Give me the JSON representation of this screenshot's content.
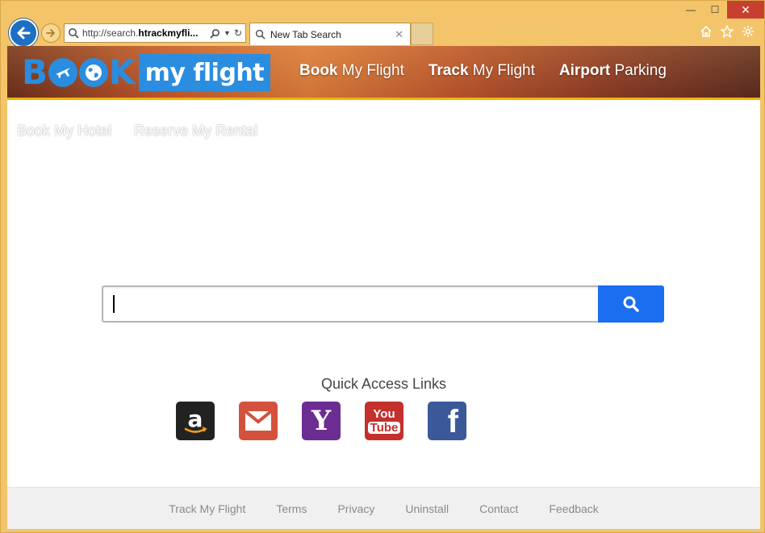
{
  "browser": {
    "address": {
      "prefix": "http://search.",
      "domain": "htrackmyfli...",
      "full_url_visible": "http://search.htrackmyfli..."
    },
    "tab": {
      "title": "New Tab Search"
    },
    "icons": [
      "home-icon",
      "star-icon",
      "gear-icon"
    ],
    "window_controls": [
      "minimize",
      "maximize",
      "close"
    ]
  },
  "site": {
    "logo": {
      "book_letters": [
        "B",
        "K"
      ],
      "box_text": "my flight",
      "brand_color": "#2a8de0"
    },
    "main_nav": [
      {
        "bold": "Book",
        "rest": " My Flight"
      },
      {
        "bold": "Track",
        "rest": " My Flight"
      },
      {
        "bold": "Airport",
        "rest": " Parking"
      }
    ],
    "sub_nav": [
      "Book My Hotel",
      "Reserve My Rental"
    ],
    "search": {
      "value": "",
      "placeholder": "",
      "button_color": "#1a6ff1"
    },
    "quick_access": {
      "title": "Quick Access Links",
      "links": [
        {
          "name": "Amazon",
          "icon": "amazon-icon",
          "glyph": "a",
          "color": "#222222"
        },
        {
          "name": "Gmail",
          "icon": "gmail-icon",
          "glyph": "✉",
          "color": "#d4523d"
        },
        {
          "name": "Yahoo",
          "icon": "yahoo-icon",
          "glyph": "Y",
          "color": "#6b2d91"
        },
        {
          "name": "YouTube",
          "icon": "youtube-icon",
          "glyph_top": "You",
          "glyph_bottom": "Tube",
          "color": "#c4302b"
        },
        {
          "name": "Facebook",
          "icon": "facebook-icon",
          "glyph": "f",
          "color": "#3b5998"
        }
      ]
    },
    "footer": [
      "Track My Flight",
      "Terms",
      "Privacy",
      "Uninstall",
      "Contact",
      "Feedback"
    ]
  }
}
